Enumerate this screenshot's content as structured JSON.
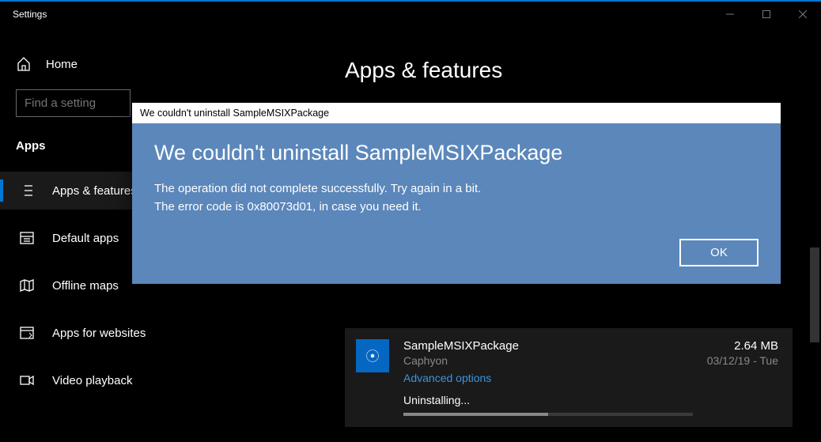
{
  "window": {
    "title": "Settings"
  },
  "sidebar": {
    "home_label": "Home",
    "search_placeholder": "Find a setting",
    "section_title": "Apps",
    "items": [
      {
        "label": "Apps & features"
      },
      {
        "label": "Default apps"
      },
      {
        "label": "Offline maps"
      },
      {
        "label": "Apps for websites"
      },
      {
        "label": "Video playback"
      }
    ]
  },
  "content": {
    "page_title": "Apps & features",
    "app": {
      "name": "SampleMSIXPackage",
      "publisher": "Caphyon",
      "advanced_label": "Advanced options",
      "status": "Uninstalling...",
      "size": "2.64 MB",
      "date": "03/12/19 - Tue"
    }
  },
  "dialog": {
    "titlebar": "We couldn't uninstall SampleMSIXPackage",
    "heading": "We couldn't uninstall SampleMSIXPackage",
    "message_line1": "The operation did not complete successfully. Try again in a bit.",
    "message_line2": "The error code is 0x80073d01, in case you need it.",
    "ok_label": "OK"
  }
}
